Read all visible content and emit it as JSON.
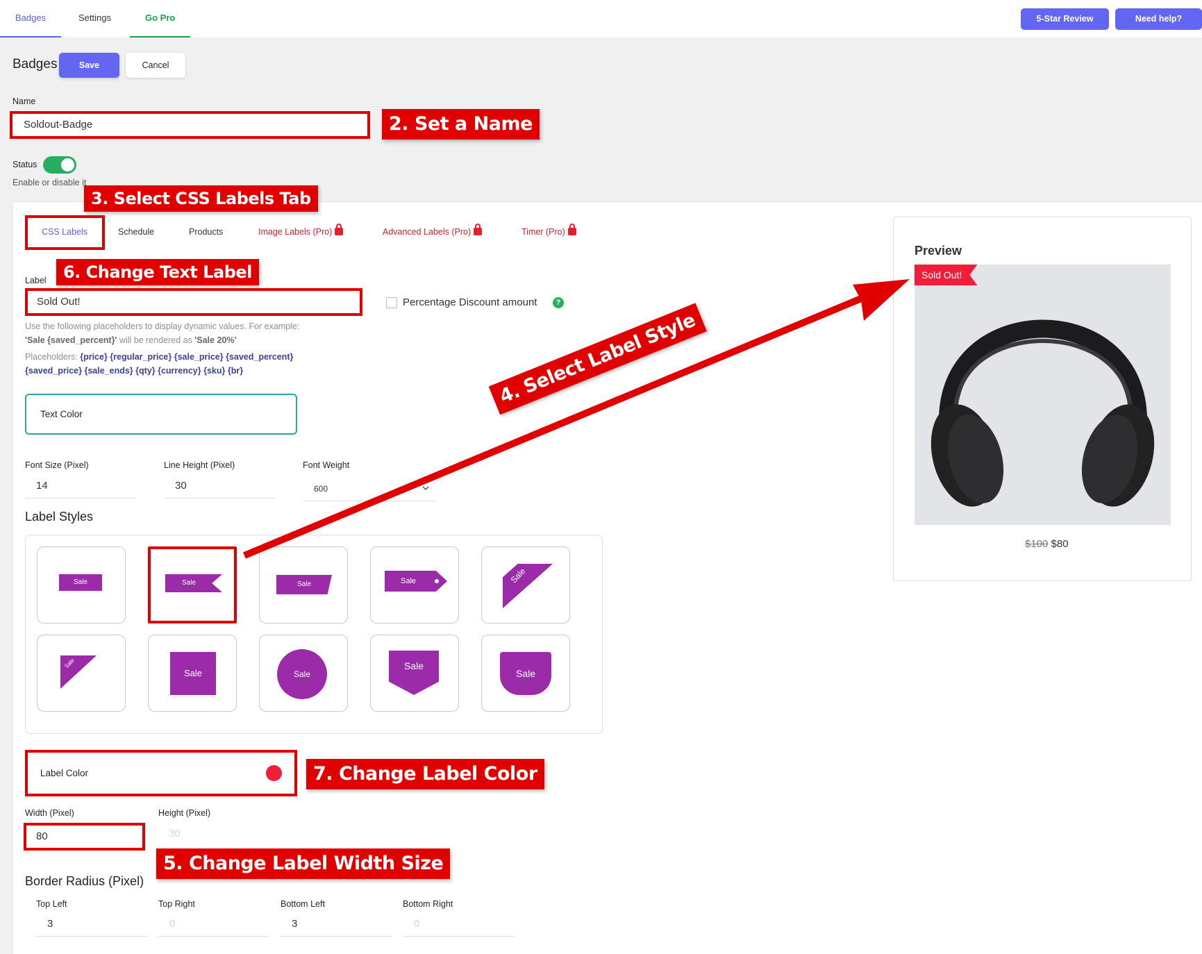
{
  "nav": {
    "tabs": [
      "Badges",
      "Settings",
      "Go Pro"
    ],
    "review_btn": "5-Star Review",
    "help_btn": "Need help?"
  },
  "header": {
    "title": "Badges",
    "save": "Save",
    "cancel": "Cancel"
  },
  "name": {
    "label": "Name",
    "value": "Soldout-Badge"
  },
  "status": {
    "label": "Status",
    "hint": "Enable or disable it",
    "enabled": true
  },
  "subtabs": [
    "CSS Labels",
    "Schedule",
    "Products",
    "Image Labels (Pro)",
    "Advanced Labels (Pro)",
    "Timer (Pro)"
  ],
  "label": {
    "label": "Label",
    "value": "Sold Out!",
    "pct_checkbox": "Percentage Discount amount",
    "help": "?",
    "hint1": "Use the following placeholders to display dynamic values. For example:",
    "hint2a": "'Sale {saved_percent}'",
    "hint2b": " will be rendered as ",
    "hint2c": "'Sale 20%'",
    "ph_label": "Placeholders: ",
    "ph1": "{price} {regular_price} {sale_price} {saved_percent}",
    "ph2": "{saved_price} {sale_ends} {qty} {currency} {sku} {br}"
  },
  "text_color": {
    "label": "Text Color"
  },
  "font": {
    "size_label": "Font Size (Pixel)",
    "size": "14",
    "lh_label": "Line Height (Pixel)",
    "lh": "30",
    "weight_label": "Font Weight",
    "weight": "600"
  },
  "label_styles": {
    "title": "Label Styles",
    "badge_text": "Sale",
    "selected_index": 1
  },
  "label_color": {
    "label": "Label Color",
    "color": "#f01e38"
  },
  "size": {
    "width_label": "Width (Pixel)",
    "width": "80",
    "height_label": "Height (Pixel)",
    "height": "30"
  },
  "radius": {
    "title": "Border Radius (Pixel)",
    "tl_label": "Top Left",
    "tl": "3",
    "tr_label": "Top Right",
    "tr": "0",
    "bl_label": "Bottom Left",
    "bl": "3",
    "br_label": "Bottom Right",
    "br": "0"
  },
  "preview": {
    "title": "Preview",
    "badge": "Sold Out!",
    "old_price": "$100",
    "new_price": "$80"
  },
  "callouts": {
    "c2": "2. Set a Name",
    "c3": "3. Select CSS Labels Tab",
    "c4": "4. Select Label Style",
    "c5": "5. Change Label Width Size",
    "c6": "6. Change Text Label",
    "c7": "7. Change Label Color"
  },
  "colors": {
    "accent": "#6366f1",
    "pro": "#1aa04c",
    "badge": "#9b2ba8",
    "annotation": "#e00000"
  }
}
